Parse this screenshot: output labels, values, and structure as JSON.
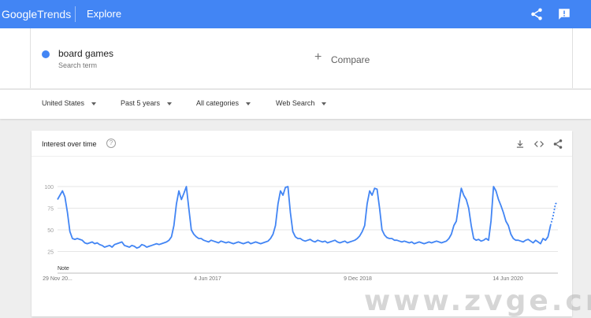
{
  "header": {
    "brand_google": "Google",
    "brand_trends": "Trends",
    "page": "Explore"
  },
  "search": {
    "term": "board games",
    "term_type": "Search term",
    "compare_plus": "+",
    "compare_label": "Compare"
  },
  "filters": {
    "region": "United States",
    "time": "Past 5 years",
    "category": "All categories",
    "property": "Web Search"
  },
  "card": {
    "title": "Interest over time",
    "help": "?"
  },
  "colors": {
    "brand": "#4285f4",
    "line": "#4285f4"
  },
  "chart_data": {
    "type": "line",
    "title": "Interest over time",
    "yticks": [
      100,
      75,
      50,
      25
    ],
    "ylim": [
      0,
      100
    ],
    "xtick_labels": [
      "29 Nov 20...",
      "4 Jun 2017",
      "9 Dec 2018",
      "14 Jun 2020"
    ],
    "annotation": "Note",
    "grid": true,
    "series": [
      {
        "values": [
          85,
          90,
          95,
          88,
          70,
          48,
          40,
          39,
          40,
          39,
          38,
          35,
          34,
          35,
          36,
          34,
          35,
          33,
          32,
          30,
          31,
          32,
          30,
          33,
          34,
          35,
          36,
          32,
          31,
          30,
          32,
          31,
          29,
          30,
          33,
          32,
          30,
          31,
          32,
          33,
          34,
          33,
          34,
          35,
          36,
          38,
          42,
          55,
          80,
          95,
          85,
          92,
          100,
          75,
          50,
          45,
          42,
          40,
          40,
          38,
          37,
          36,
          38,
          37,
          36,
          35,
          37,
          36,
          35,
          36,
          35,
          34,
          35,
          36,
          35,
          34,
          35,
          36,
          34,
          35,
          36,
          35,
          34,
          35,
          36,
          37,
          40,
          45,
          55,
          80,
          95,
          90,
          99,
          100,
          70,
          48,
          42,
          40,
          40,
          38,
          37,
          38,
          39,
          37,
          36,
          38,
          37,
          36,
          37,
          35,
          36,
          37,
          38,
          36,
          35,
          36,
          37,
          35,
          36,
          37,
          38,
          40,
          43,
          48,
          55,
          80,
          95,
          90,
          98,
          97,
          75,
          50,
          44,
          41,
          40,
          40,
          38,
          38,
          37,
          36,
          37,
          36,
          35,
          36,
          34,
          35,
          36,
          35,
          34,
          35,
          36,
          35,
          36,
          37,
          36,
          35,
          36,
          37,
          40,
          45,
          55,
          60,
          80,
          98,
          90,
          85,
          75,
          55,
          40,
          38,
          39,
          37,
          38,
          40,
          38,
          60,
          100,
          95,
          85,
          78,
          70,
          60,
          55,
          45,
          40,
          38,
          38,
          37,
          36,
          38,
          39,
          37,
          35,
          38,
          36,
          34,
          40,
          38,
          42,
          55,
          65,
          80,
          82
        ]
      }
    ]
  }
}
